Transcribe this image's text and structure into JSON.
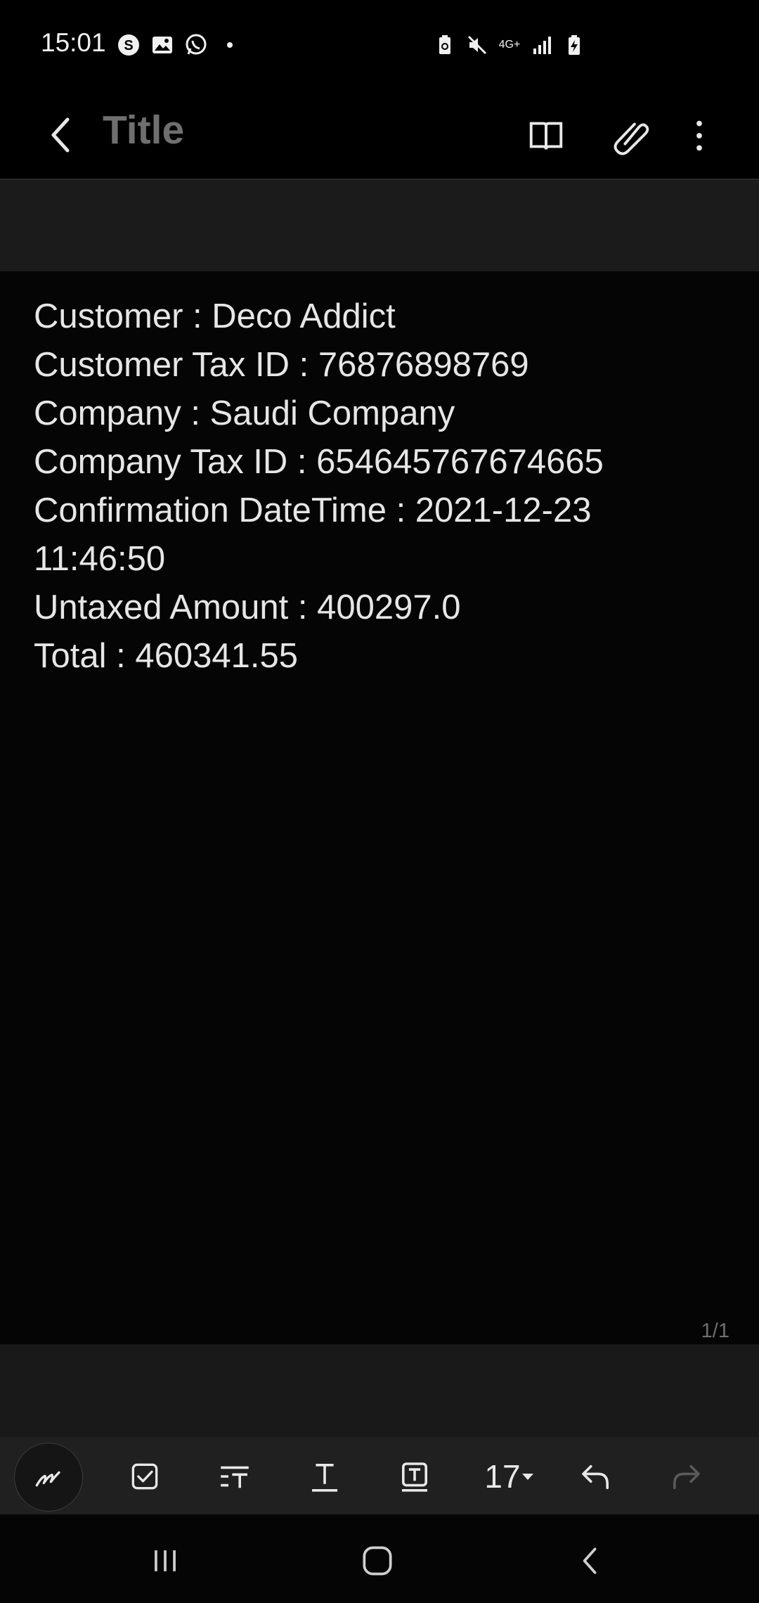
{
  "status_bar": {
    "time": "15:01",
    "left_icons": [
      "s-circle-icon",
      "gallery-icon",
      "whatsapp-icon",
      "dot-icon"
    ],
    "network_label_top": "4G+",
    "right_icons": [
      "battery-saver-icon",
      "mute-icon",
      "network-4g-icon",
      "signal-icon",
      "battery-charging-icon"
    ]
  },
  "app_bar": {
    "title": "Title",
    "actions": [
      "reading-mode-icon",
      "attach-icon",
      "more-options-icon"
    ]
  },
  "note": {
    "lines": [
      "Customer : Deco Addict",
      "Customer Tax ID : 76876898769",
      "Company : Saudi Company",
      "Company Tax ID : 654645767674665",
      "Confirmation DateTime : 2021-12-23",
      "11:46:50",
      "Untaxed Amount : 400297.0",
      "Total : 460341.55"
    ],
    "page_indicator": "1/1"
  },
  "toolbar": {
    "font_size": "17",
    "tools": [
      "pen-icon",
      "checkbox-icon",
      "text-format-icon",
      "text-style-icon",
      "text-box-icon",
      "font-size",
      "undo-icon",
      "redo-icon"
    ]
  },
  "nav_bar": [
    "recent-apps-icon",
    "home-icon",
    "back-icon"
  ]
}
